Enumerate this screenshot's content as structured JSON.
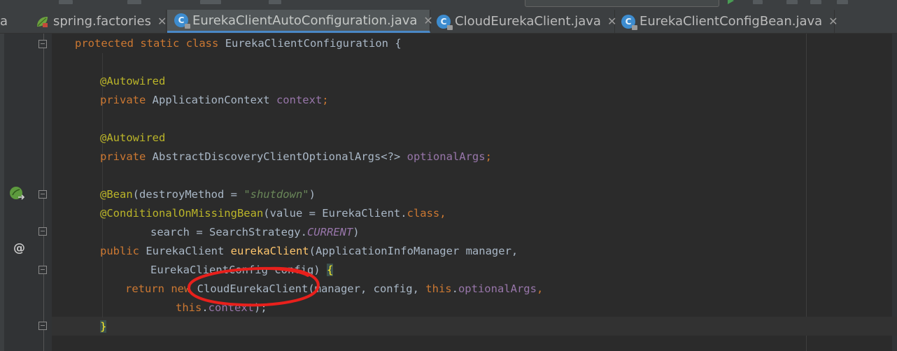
{
  "tabs": {
    "cut_label": "a",
    "items": [
      {
        "label": "spring.factories",
        "icon": "spring-leaf-icon",
        "active": false
      },
      {
        "label": "EurekaClientAutoConfiguration.java",
        "icon": "java-class-icon",
        "active": true
      },
      {
        "label": "CloudEurekaClient.java",
        "icon": "java-class-icon",
        "active": false
      },
      {
        "label": "EurekaClientConfigBean.java",
        "icon": "java-class-icon",
        "active": false
      }
    ],
    "close_glyph": "✕",
    "class_letter": "C"
  },
  "gutter": {
    "at_glyph": "@"
  },
  "code": {
    "l1": {
      "protected": "protected",
      "static": "static",
      "class": "class",
      "name": " EurekaClientConfiguration {"
    },
    "l3": {
      "ann": "@Autowired"
    },
    "l4": {
      "kw": "private",
      "type": " ApplicationContext ",
      "field": "context",
      "semi": ";"
    },
    "l6": {
      "ann": "@Autowired"
    },
    "l7": {
      "kw": "private",
      "type": " AbstractDiscoveryClientOptionalArgs<?> ",
      "field": "optionalArgs",
      "semi": ";"
    },
    "l9": {
      "ann": "@Bean",
      "open": "(destroyMethod = ",
      "str": "\"shutdown\"",
      "close": ")"
    },
    "l10": {
      "ann": "@ConditionalOnMissingBean",
      "open": "(value = EurekaClient.",
      "cls": "class",
      "comma": ","
    },
    "l11": {
      "text": "search = SearchStrategy.",
      "const": "CURRENT",
      "close": ")"
    },
    "l12": {
      "kw": "public",
      "type": " EurekaClient ",
      "method": "eurekaClient",
      "params": "(ApplicationInfoManager manager,"
    },
    "l13": {
      "params": "EurekaClientConfig config) ",
      "brace": "{"
    },
    "l14": {
      "ret": "return",
      "new": "new",
      "call": " CloudEurekaClient(manager, config, ",
      "this": "this",
      "dot": ".",
      "field": "optionalArgs",
      "comma": ","
    },
    "l15": {
      "this": "this",
      "dot": ".",
      "field": "context",
      "close": ");"
    },
    "l16": {
      "brace": "}"
    }
  }
}
